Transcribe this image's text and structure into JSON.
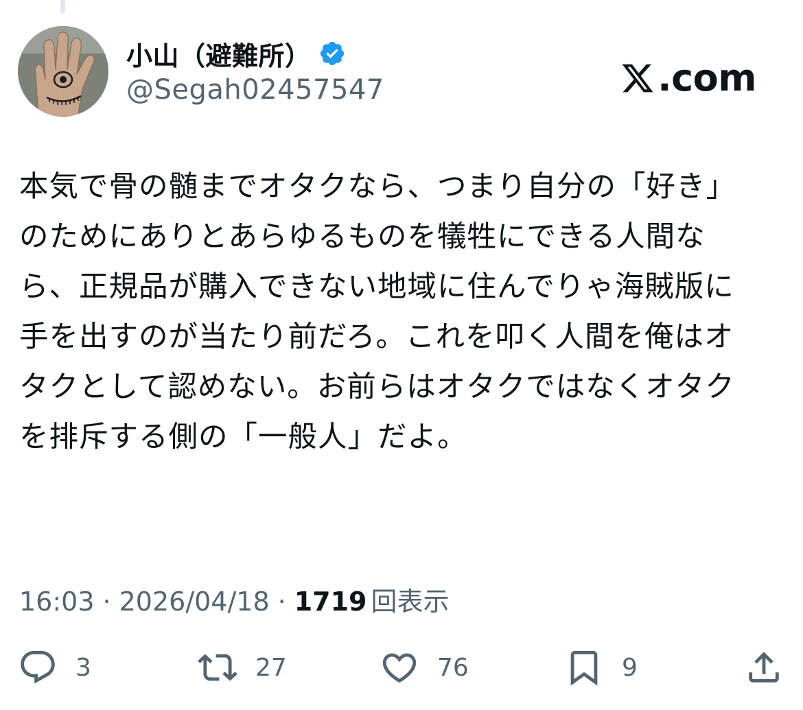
{
  "author": {
    "display_name": "小山（避難所）",
    "handle": "@Segah02457547",
    "verified": true
  },
  "brand": {
    "domain_text": ".com",
    "logo_icon": "x-logo-icon"
  },
  "tweet": {
    "text": "本気で骨の髄までオタクなら、つまり自分の「好き」のためにありとあらゆるものを犠牲にできる人間なら、正規品が購入できない地域に住んでりゃ海賊版に手を出すのが当たり前だろ。これを叩く人間を俺はオタクとして認めない。お前らはオタクではなくオタクを排斥する側の「一般人」だよ。"
  },
  "meta": {
    "time": "16:03",
    "separator": "·",
    "date": "2026/04/18",
    "views_count": "1719",
    "views_label": "回表示"
  },
  "actions": {
    "reply": {
      "icon": "reply-icon",
      "count": "3"
    },
    "retweet": {
      "icon": "retweet-icon",
      "count": "27"
    },
    "like": {
      "icon": "heart-icon",
      "count": "76"
    },
    "bookmark": {
      "icon": "bookmark-icon",
      "count": "9"
    },
    "share": {
      "icon": "share-icon"
    }
  },
  "colors": {
    "text_primary": "#0f1419",
    "text_secondary": "#536471",
    "verified_blue": "#1d9bf0"
  }
}
